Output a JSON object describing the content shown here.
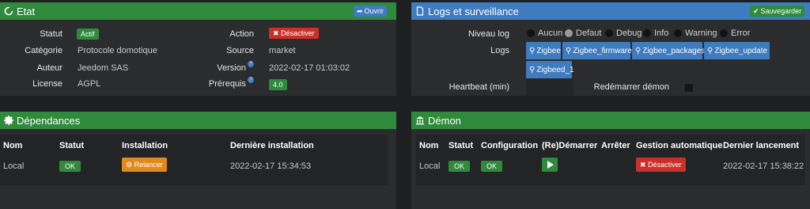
{
  "colors": {
    "green": "#2f8a3c",
    "blue": "#3e7bbf",
    "red": "#c9302c",
    "orange": "#e08a1e",
    "bg": "#1e1f21"
  },
  "etat": {
    "title": "Etat",
    "open_btn": "Ouvrir",
    "rows": [
      {
        "label": "Statut",
        "value": "Actif"
      },
      {
        "label": "Catégorie",
        "value": "Protocole domotique"
      },
      {
        "label": "Auteur",
        "value": "Jeedom SAS"
      },
      {
        "label": "License",
        "value": "AGPL"
      }
    ],
    "right_rows": [
      {
        "label": "Action",
        "value": "Désactiver"
      },
      {
        "label": "Source",
        "value": "market"
      },
      {
        "label": "Version",
        "value": "2022-02-17 01:03:02"
      },
      {
        "label": "Prérequis",
        "value": "4.0"
      }
    ]
  },
  "logs": {
    "title": "Logs et surveillance",
    "save_btn": "Sauvegarder",
    "level_label": "Niveau log",
    "levels": [
      "Aucun",
      "Defaut",
      "Debug",
      "Info",
      "Warning",
      "Error"
    ],
    "selected_level": "Defaut",
    "logs_label": "Logs",
    "log_buttons": [
      "Zigbee",
      "Zigbee_firmware",
      "Zigbee_packages",
      "Zigbee_update",
      "Zigbeed_1"
    ],
    "heartbeat_label": "Heartbeat (min)",
    "heartbeat_value": "",
    "restart_label": "Redémarrer démon"
  },
  "deps": {
    "title": "Dépendances",
    "headers": [
      "Nom",
      "Statut",
      "Installation",
      "Dernière installation"
    ],
    "row": {
      "name": "Local",
      "status": "OK",
      "action": "Relancer",
      "date": "2022-02-17 15:34:53"
    }
  },
  "demon": {
    "title": "Démon",
    "headers": [
      "Nom",
      "Statut",
      "Configuration",
      "(Re)Démarrer",
      "Arrêter",
      "Gestion automatique",
      "Dernier lancement"
    ],
    "row": {
      "name": "Local",
      "status": "OK",
      "config": "OK",
      "auto": "Désactiver",
      "date": "2022-02-17 15:38:22"
    }
  }
}
